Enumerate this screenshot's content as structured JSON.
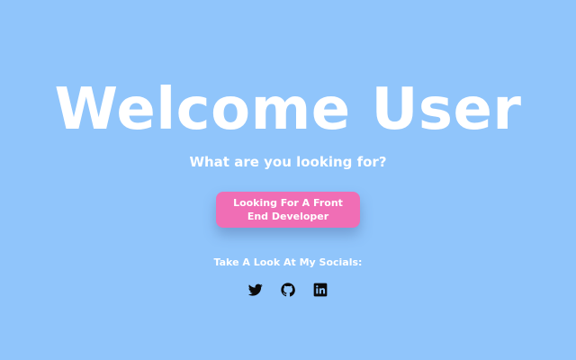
{
  "hero": {
    "title": "Welcome User",
    "subtitle": "What are you looking for?",
    "cta_label": "Looking For A Front End Developer"
  },
  "socials": {
    "label": "Take A Look At My Socials:",
    "items": [
      {
        "name": "twitter",
        "icon": "twitter-icon"
      },
      {
        "name": "github",
        "icon": "github-icon"
      },
      {
        "name": "linkedin",
        "icon": "linkedin-icon"
      }
    ]
  },
  "colors": {
    "background": "#90c5fb",
    "text": "#ffffff",
    "cta_background": "#f06eb5",
    "icon": "#0b0b0b"
  }
}
